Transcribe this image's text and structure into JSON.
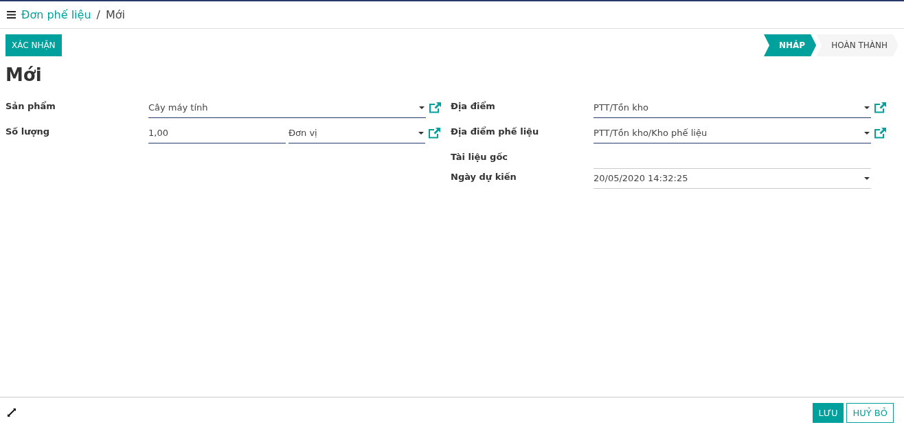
{
  "breadcrumb": [
    {
      "label": "Đơn phế liệu",
      "link": true
    },
    {
      "label": "Mới",
      "link": false
    }
  ],
  "breadcrumb_separator": "/",
  "actions": [
    {
      "label": "XÁC NHẬN"
    }
  ],
  "stages": [
    {
      "label": "NHÁP",
      "selected": true
    },
    {
      "label": "HOÀN THÀNH",
      "selected": false
    }
  ],
  "title": "Mới",
  "left_fields": [
    {
      "label": "Sản phẩm",
      "kind": "many2one",
      "required": true,
      "value": "Cây máy tính"
    },
    {
      "label": "Số lượng",
      "kind": "quantity",
      "required": true,
      "value": "1,00",
      "unit": "Đơn vị"
    }
  ],
  "right_fields": [
    {
      "label": "Địa điểm",
      "kind": "many2one",
      "required": true,
      "value": "PTT/Tồn kho"
    },
    {
      "label": "Địa điểm phế liệu",
      "kind": "many2one",
      "required": true,
      "value": "PTT/Tồn kho/Kho phế liệu"
    },
    {
      "label": "Tài liệu gốc",
      "kind": "text",
      "required": false
    },
    {
      "label": "Ngày dự kiến",
      "kind": "datetime",
      "required": false,
      "value": "20/05/2020 14:32:25"
    }
  ],
  "footer_buttons": [
    {
      "label": "LƯU",
      "primary": true
    },
    {
      "label": "HUỶ BỎ",
      "primary": false
    }
  ]
}
